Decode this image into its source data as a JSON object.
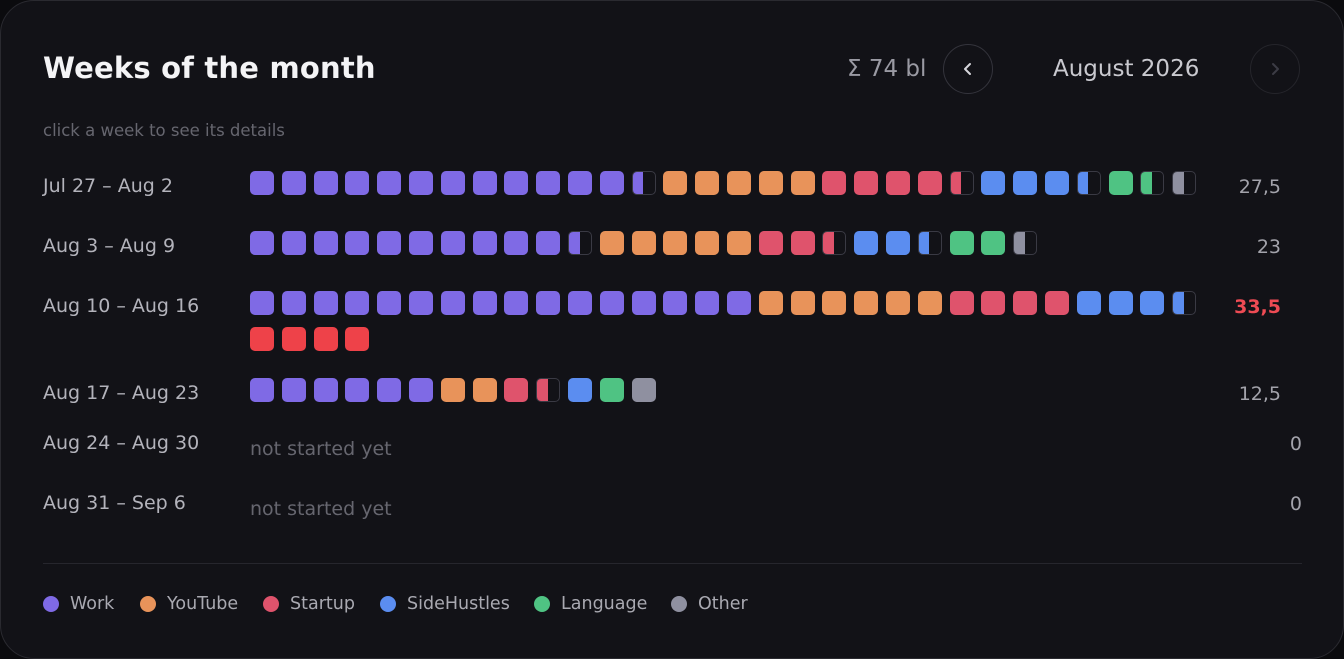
{
  "header": {
    "title": "Weeks of the month",
    "total": "Σ 74 bl",
    "month": "August 2026",
    "prev_icon": "chevron-left-icon",
    "next_icon": "chevron-right-icon"
  },
  "hint": "click a week to see its details",
  "colors": {
    "Work": "#7f6ae5",
    "YouTube": "#e8935a",
    "Startup": "#df536c",
    "Over": "#ee4249",
    "SideHustles": "#5b8df0",
    "Language": "#4fc383",
    "Other": "#8f90a0",
    "over_total": "#ee4b54"
  },
  "weeks": [
    {
      "label": "Jul 27 – Aug 2",
      "total": "27,5",
      "over": false,
      "blocks": [
        {
          "category": "Work",
          "count": 12.5
        },
        {
          "category": "YouTube",
          "count": 5
        },
        {
          "category": "Startup",
          "count": 4.5
        },
        {
          "category": "SideHustles",
          "count": 3.5
        },
        {
          "category": "Language",
          "count": 1.5
        },
        {
          "category": "Other",
          "count": 0.5
        }
      ]
    },
    {
      "label": "Aug 3 – Aug 9",
      "total": "23",
      "over": false,
      "blocks": [
        {
          "category": "Work",
          "count": 10.5
        },
        {
          "category": "YouTube",
          "count": 5
        },
        {
          "category": "Startup",
          "count": 2.5
        },
        {
          "category": "SideHustles",
          "count": 2.5
        },
        {
          "category": "Language",
          "count": 2
        },
        {
          "category": "Other",
          "count": 0.5
        }
      ]
    },
    {
      "label": "Aug 10 – Aug 16",
      "total": "33,5",
      "over": true,
      "blocks": [
        {
          "category": "Work",
          "count": 16
        },
        {
          "category": "YouTube",
          "count": 6
        },
        {
          "category": "Startup",
          "count": 4
        },
        {
          "category": "SideHustles",
          "count": 3.5
        },
        {
          "category": "Over",
          "count": 4
        }
      ]
    },
    {
      "label": "Aug 17 – Aug 23",
      "total": "12,5",
      "over": false,
      "blocks": [
        {
          "category": "Work",
          "count": 6
        },
        {
          "category": "YouTube",
          "count": 2
        },
        {
          "category": "Startup",
          "count": 1.5
        },
        {
          "category": "SideHustles",
          "count": 1
        },
        {
          "category": "Language",
          "count": 1
        },
        {
          "category": "Other",
          "count": 1
        }
      ]
    },
    {
      "label": "Aug 24 – Aug 30",
      "total": "0",
      "over": false,
      "empty_note": "not started yet",
      "blocks": []
    },
    {
      "label": "Aug 31 – Sep 6",
      "total": "0",
      "over": false,
      "empty_note": "not started yet",
      "blocks": []
    }
  ],
  "legend": [
    {
      "label": "Work",
      "category": "Work"
    },
    {
      "label": "YouTube",
      "category": "YouTube"
    },
    {
      "label": "Startup",
      "category": "Startup"
    },
    {
      "label": "SideHustles",
      "category": "SideHustles"
    },
    {
      "label": "Language",
      "category": "Language"
    },
    {
      "label": "Other",
      "category": "Other"
    }
  ]
}
